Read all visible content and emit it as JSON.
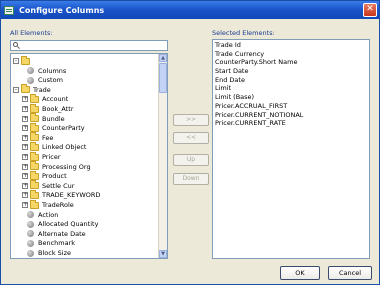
{
  "window": {
    "title": "Configure Columns",
    "close_glyph": "✕"
  },
  "left": {
    "label": "All Elements:",
    "search_value": "",
    "tree": [
      {
        "text": "",
        "type": "folder",
        "expander": "-"
      },
      {
        "text": "Columns",
        "type": "leaf",
        "expander": ""
      },
      {
        "text": "Custom",
        "type": "leaf",
        "expander": ""
      },
      {
        "text": "Trade",
        "type": "folder",
        "expander": "-"
      },
      {
        "text": "Account",
        "type": "folder",
        "expander": "+"
      },
      {
        "text": "Book_Attr",
        "type": "folder",
        "expander": "+"
      },
      {
        "text": "Bundle",
        "type": "folder",
        "expander": "+"
      },
      {
        "text": "CounterParty",
        "type": "folder",
        "expander": "+"
      },
      {
        "text": "Fee",
        "type": "folder",
        "expander": "+"
      },
      {
        "text": "Linked Object",
        "type": "folder",
        "expander": "+"
      },
      {
        "text": "Pricer",
        "type": "folder",
        "expander": "+"
      },
      {
        "text": "Processing Org",
        "type": "folder",
        "expander": "+"
      },
      {
        "text": "Product",
        "type": "folder",
        "expander": "+"
      },
      {
        "text": "Settle Cur",
        "type": "folder",
        "expander": "+"
      },
      {
        "text": "TRADE_KEYWORD",
        "type": "folder",
        "expander": "+"
      },
      {
        "text": "TradeRole",
        "type": "folder",
        "expander": "+"
      },
      {
        "text": "Action",
        "type": "leaf",
        "expander": ""
      },
      {
        "text": "Allocated Quantity",
        "type": "leaf",
        "expander": ""
      },
      {
        "text": "Alternate Date",
        "type": "leaf",
        "expander": ""
      },
      {
        "text": "Benchmark",
        "type": "leaf",
        "expander": ""
      },
      {
        "text": "Block Size",
        "type": "leaf",
        "expander": ""
      }
    ]
  },
  "middle": {
    "add_label": ">>",
    "remove_label": "<<",
    "up_label": "Up",
    "down_label": "Down"
  },
  "right": {
    "label": "Selected Elements:",
    "items": [
      "Trade Id",
      "Trade Currency",
      "CounterParty.Short Name",
      "Start Date",
      "End Date",
      "Limit",
      "Limit (Base)",
      "Pricer.ACCRUAL_FIRST",
      "Pricer.CURRENT_NOTIONAL",
      "Pricer.CURRENT_RATE"
    ]
  },
  "footer": {
    "ok_label": "OK",
    "cancel_label": "Cancel"
  },
  "colors": {
    "title_bar": "#1853c8",
    "label_text": "#1a3a8f",
    "close": "#c9361c"
  }
}
